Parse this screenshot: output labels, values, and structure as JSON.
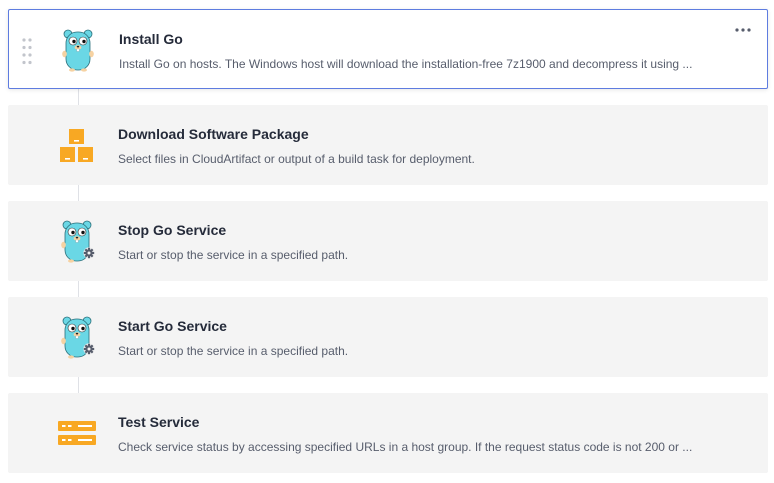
{
  "steps": [
    {
      "title": "Install Go",
      "description": "Install Go on hosts. The Windows host will download the installation-free 7z1900 and decompress it using ...",
      "icon": "gopher-icon",
      "selected": true
    },
    {
      "title": "Download Software Package",
      "description": "Select files in CloudArtifact or output of a build task for deployment.",
      "icon": "package-boxes-icon",
      "selected": false
    },
    {
      "title": "Stop Go Service",
      "description": "Start or stop the service in a specified path.",
      "icon": "gopher-gear-icon",
      "selected": false
    },
    {
      "title": "Start Go Service",
      "description": "Start or stop the service in a specified path.",
      "icon": "gopher-gear-icon",
      "selected": false
    },
    {
      "title": "Test Service",
      "description": "Check service status by accessing specified URLs in a host group. If the request status code is not 200 or ...",
      "icon": "server-rack-icon",
      "selected": false
    }
  ],
  "colors": {
    "accent": "#5e7ce0",
    "gopher": "#6ad7e5",
    "orange": "#f8a823",
    "card_bg": "#f4f4f4"
  }
}
